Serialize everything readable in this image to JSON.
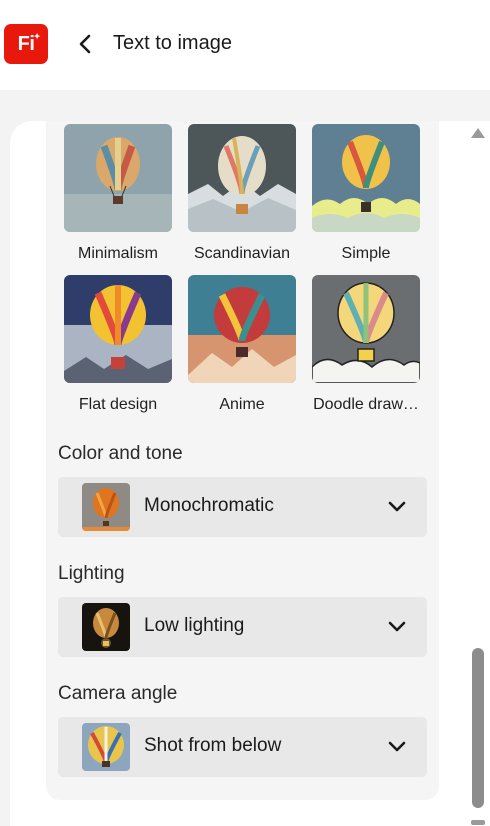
{
  "app": {
    "logo_text": "Fi",
    "title": "Text to image"
  },
  "styles": [
    {
      "label": "Minimalism"
    },
    {
      "label": "Scandinavian"
    },
    {
      "label": "Simple"
    },
    {
      "label": "Flat design"
    },
    {
      "label": "Anime"
    },
    {
      "label": "Doodle draw…"
    }
  ],
  "color_tone": {
    "label": "Color and tone",
    "value": "Monochromatic"
  },
  "lighting": {
    "label": "Lighting",
    "value": "Low lighting"
  },
  "camera_angle": {
    "label": "Camera angle",
    "value": "Shot from below"
  },
  "colors": {
    "logo": "#e8180c",
    "panel": "#f5f5f5",
    "dropdown": "#e8e8e8"
  }
}
